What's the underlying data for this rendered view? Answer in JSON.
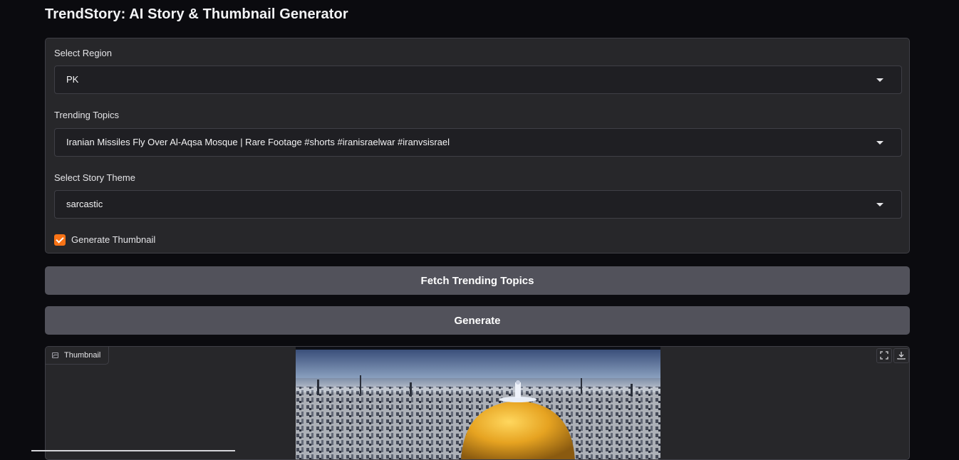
{
  "app": {
    "title": "TrendStory: AI Story & Thumbnail Generator"
  },
  "form": {
    "region": {
      "label": "Select Region",
      "value": "PK"
    },
    "topics": {
      "label": "Trending Topics",
      "value": "Iranian Missiles Fly Over Al-Aqsa Mosque | Rare Footage #shorts #iranisraelwar #iranvsisrael"
    },
    "theme": {
      "label": "Select Story Theme",
      "value": "sarcastic"
    },
    "thumbnail_checkbox": {
      "label": "Generate Thumbnail",
      "checked": true
    }
  },
  "buttons": {
    "fetch_label": "Fetch Trending Topics",
    "generate_label": "Generate"
  },
  "thumbnail": {
    "tab_label": "Thumbnail",
    "icons": [
      "image-icon",
      "fullscreen-icon",
      "download-icon"
    ]
  },
  "colors": {
    "background": "#0b0b0f",
    "panel": "#27272a",
    "button": "#52525b",
    "accent": "#f97316"
  }
}
